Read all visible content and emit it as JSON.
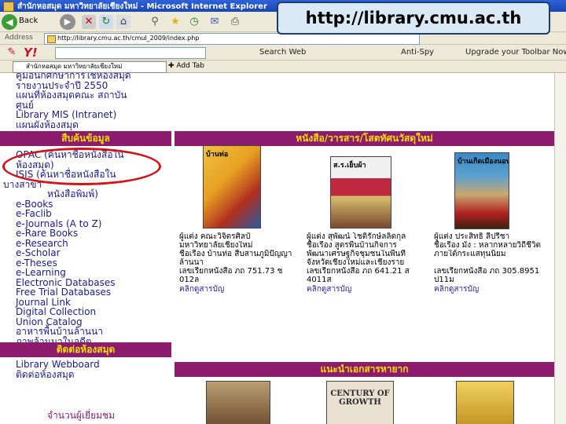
{
  "window": {
    "title": "สำนักหอสมุด มหาวิทยาลัยเชียงใหม่ - Microsoft Internet Explorer"
  },
  "toolbar": {
    "back_label": "Back"
  },
  "address": {
    "label": "Address",
    "url": "http://library.cmu.ac.th/cmul_2009/index.php"
  },
  "yahoo": {
    "logo": "Y!",
    "search_button": "Search Web",
    "antispy": "Anti-Spy",
    "upgrade": "Upgrade your Toolbar Now"
  },
  "favorites": {
    "tab_title": "สำนักหอสมุด มหาวิทยาลัยเชียงใหม่",
    "add_tab": "Add Tab"
  },
  "callout": {
    "url": "http://library.cmu.ac.th"
  },
  "sidebar": {
    "top_items": [
      "คู่มือนักศึกษาการใช้ห้องสมุด",
      "รายงานประจำปี 2550",
      "แผนที่ห้องสมุดคณะ สถาบัน",
      "ศูนย์",
      "Library MIS (Intranet)",
      "แผนผังห้องสมุด"
    ],
    "section1_title": "สืบค้นข้อมูล",
    "search_items": [
      "OPAC (ค้นหาชื่อหนังสือใน",
      "ห้องสมุด)",
      "ISIS (ค้นหาชื่อหนังสือใน",
      "บางสาขา",
      "หนังสือพิมพ์)",
      "e-Books",
      "e-Faclib",
      "e-Journals (A to Z)",
      "e-Rare Books",
      "e-Research",
      "e-Scholar",
      "e-Theses",
      "e-Learning",
      "Electronic Databases",
      "Free Trial Databases",
      "Journal Link",
      "Digital Collection",
      "Union Catalog",
      "อาหารพื้นบ้านล้านนา",
      "ภาพล้านนาในอดีต",
      "เพลงล้านนา"
    ],
    "section2_title": "ติดต่อห้องสมุด",
    "contact_items": [
      "Library Webboard",
      "ติดต่อห้องสมุด"
    ],
    "visitor_label": "จำนวนผู้เยี่ยมชม"
  },
  "main": {
    "new_books_title": "หนังสือ/วารสาร/โสตทัศนวัสดุใหม่",
    "books": [
      {
        "cover_title": "บ้านท่อ",
        "author": "ผู้แต่ง คณะวิจิตรศิลป์",
        "publisher": "มหาวิทยาลัยเชียงใหม่",
        "title_line": "ชื่อเรื่อง บ้านท่อ สืบสานภูมิปัญญา",
        "extra": "ล้านนา",
        "callno": "เลขเรียกหนังสือ ภถ 751.73 ช",
        "callno2": "012ล",
        "link": "คลิกดูสารบัญ"
      },
      {
        "cover_title": "ส.ร.เย็บผ้า",
        "author": "ผู้แต่ง สุพัฒน์ โชติรักษ์ลลิตกุล",
        "publisher": "ชื่อเรื่อง สูตรพื้นบ้านกิจการ",
        "title_line": "พัฒนาเศรษฐกิจชุมชนในพื้นที่",
        "extra": "จังหวัดเชียงใหม่และเชียงราย",
        "callno": "เลขเรียกหนังสือ ภถ 641.21 ส",
        "callno2": "4011ส",
        "link": "คลิกดูสารบัญ"
      },
      {
        "cover_title": "บ้านเกิดเมืองนอน",
        "author": "ผู้แต่ง ประสิทธิ์ ลีปรีชา",
        "publisher": "ชื่อเรื่อง มัง : หลากหลายวิถีชีวิต",
        "title_line": "ภายใต้กระแสทุนนิยม",
        "extra": "",
        "callno": "เลขเรียกหนังสือ ภถ 305.8951",
        "callno2": "ป11ม",
        "link": "คลิกดูสารบัญ"
      }
    ],
    "rare_docs_title": "แนะนำเอกสารหายาก",
    "rare_cover": "CENTURY OF GROWTH"
  },
  "colors": {
    "header_bg": "#8e1c6e",
    "header_text": "#f4e000",
    "highlight_oval": "#d4141a",
    "link": "#1b1b8a"
  }
}
